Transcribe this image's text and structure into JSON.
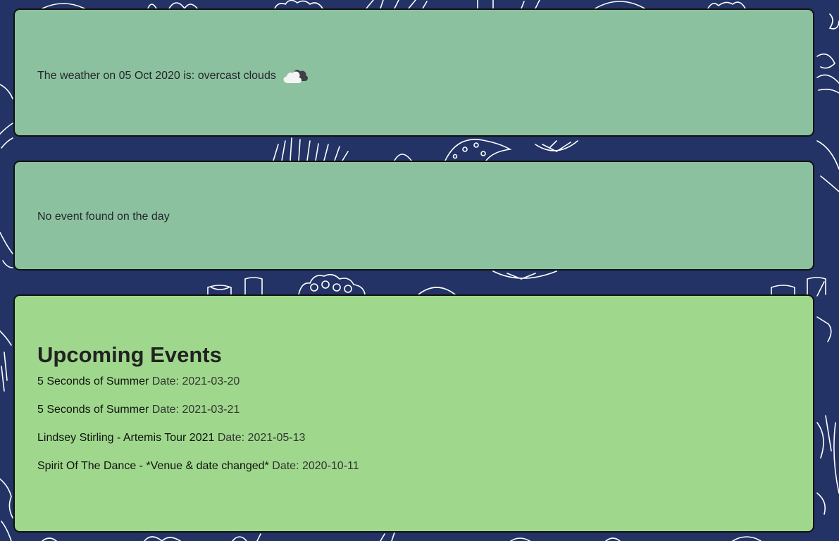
{
  "weather": {
    "text": "The weather on 05 Oct 2020 is: overcast clouds",
    "icon": "overcast-clouds-icon"
  },
  "day_events": {
    "message": "No event found on the day"
  },
  "upcoming": {
    "title": "Upcoming Events",
    "date_label": "Date:",
    "items": [
      {
        "name": "5 Seconds of Summer",
        "date": "2021-03-20"
      },
      {
        "name": "5 Seconds of Summer",
        "date": "2021-03-21"
      },
      {
        "name": "Lindsey Stirling - Artemis Tour 2021",
        "date": "2021-05-13"
      },
      {
        "name": "Spirit Of The Dance - *Venue & date changed*",
        "date": "2020-10-11"
      }
    ]
  },
  "colors": {
    "background": "#233366",
    "weather_card": "#8cc1a0",
    "upcoming_card": "#9fd88c"
  }
}
